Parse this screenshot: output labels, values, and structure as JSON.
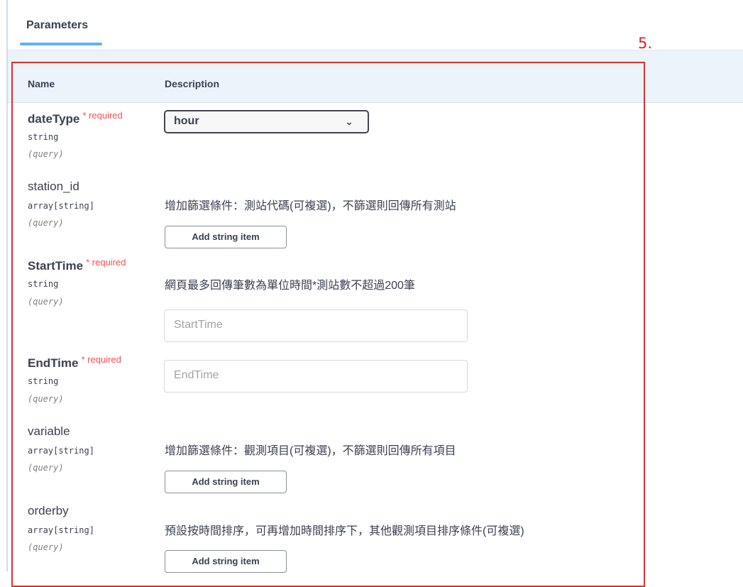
{
  "tab": {
    "label": "Parameters"
  },
  "annotation": {
    "label": "5."
  },
  "columns": {
    "name": "Name",
    "description": "Description"
  },
  "params": {
    "dateType": {
      "name": "dateType",
      "required": "* required",
      "type": "string",
      "in": "(query)",
      "select_value": "hour"
    },
    "station_id": {
      "name": "station_id",
      "type": "array[string]",
      "in": "(query)",
      "description": "增加篩選條件：測站代碼(可複選)，不篩選則回傳所有測站",
      "button": "Add string item"
    },
    "StartTime": {
      "name": "StartTime",
      "required": "* required",
      "type": "string",
      "in": "(query)",
      "description": "網頁最多回傳筆數為單位時間*測站數不超過200筆",
      "placeholder": "StartTime"
    },
    "EndTime": {
      "name": "EndTime",
      "required": "* required",
      "type": "string",
      "in": "(query)",
      "placeholder": "EndTime"
    },
    "variable": {
      "name": "variable",
      "type": "array[string]",
      "in": "(query)",
      "description": "增加篩選條件：觀測項目(可複選)，不篩選則回傳所有項目",
      "button": "Add string item"
    },
    "orderby": {
      "name": "orderby",
      "type": "array[string]",
      "in": "(query)",
      "description": "預設按時間排序，可再增加時間排序下，其他觀測項目排序條件(可複選)",
      "button": "Add string item"
    }
  },
  "icons": {
    "select_chevron": "chevron-down-icon"
  },
  "colors": {
    "tab_underline": "#61affe",
    "required": "#ff4d4d",
    "annotation": "#e03030",
    "header_band": "#ebf3fb"
  }
}
